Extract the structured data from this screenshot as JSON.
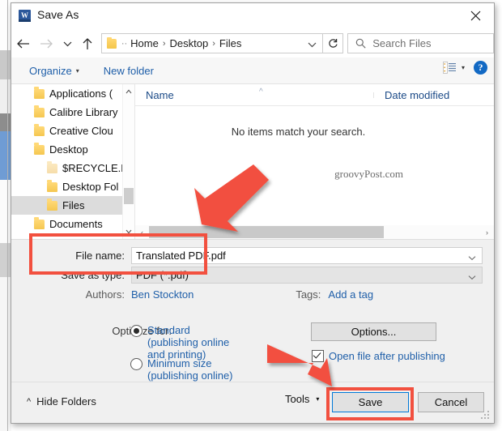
{
  "window": {
    "title": "Save As",
    "app_icon": "word-icon",
    "close_label": "✕"
  },
  "nav": {
    "back_icon": "back-arrow-icon",
    "forward_icon": "forward-arrow-icon",
    "recent_icon": "chevron-down-icon",
    "up_icon": "up-arrow-icon",
    "refresh_icon": "refresh-icon",
    "breadcrumb": [
      "Home",
      "Desktop",
      "Files"
    ],
    "breadcrumb_separator": "›",
    "address_chevron": "chevron-down-icon",
    "search": {
      "placeholder": "Search Files",
      "icon": "search-icon"
    }
  },
  "toolbar": {
    "organize_label": "Organize",
    "new_folder_label": "New folder",
    "caret": "▾",
    "view_icon": "list-view-icon",
    "view_caret": "▾",
    "help_label": "?"
  },
  "navpane": {
    "items": [
      {
        "label": "Applications (",
        "indent": 1,
        "selected": false,
        "pale": false
      },
      {
        "label": "Calibre Library",
        "indent": 1,
        "selected": false,
        "pale": false
      },
      {
        "label": "Creative Clou",
        "indent": 1,
        "selected": false,
        "pale": false
      },
      {
        "label": "Desktop",
        "indent": 1,
        "selected": false,
        "pale": false
      },
      {
        "label": "$RECYCLE.BI",
        "indent": 2,
        "selected": false,
        "pale": true
      },
      {
        "label": "Desktop Fol",
        "indent": 2,
        "selected": false,
        "pale": false
      },
      {
        "label": "Files",
        "indent": 2,
        "selected": true,
        "pale": false
      },
      {
        "label": "Documents",
        "indent": 1,
        "selected": false,
        "pale": false
      }
    ],
    "scroll_up": "▲",
    "scroll_down": "▼"
  },
  "filepane": {
    "columns": [
      "Name",
      "Date modified"
    ],
    "sort_indicator": "^",
    "empty_message": "No items match your search.",
    "watermark": "groovyPost.com",
    "hscroll_left": "‹",
    "hscroll_right": "›"
  },
  "form": {
    "file_name_label": "File name:",
    "file_name_value": "Translated PDF.pdf",
    "save_as_type_label": "Save as type:",
    "save_as_type_value": "PDF (*.pdf)",
    "authors_label": "Authors:",
    "authors_value": "Ben Stockton",
    "tags_label": "Tags:",
    "tags_value": "Add a tag",
    "optimize_label": "Optimize for:",
    "optimize_options": [
      {
        "label": "Standard (publishing online and printing)",
        "selected": true
      },
      {
        "label": "Minimum size (publishing online)",
        "selected": false
      }
    ],
    "options_button": "Options...",
    "open_after_publishing_label": "Open file after publishing",
    "open_after_publishing_checked": true
  },
  "footer": {
    "hide_folders_label": "Hide Folders",
    "hide_folders_caret": "^",
    "tools_label": "Tools",
    "tools_caret": "▾",
    "save_label": "Save",
    "cancel_label": "Cancel"
  },
  "annotations": {
    "highlight_color": "#f2503f",
    "arrow_color": "#f2503f",
    "boxes": [
      "file-name-and-type",
      "save-button"
    ],
    "arrows": [
      "points-to-file-name-area",
      "points-to-save-button"
    ]
  }
}
